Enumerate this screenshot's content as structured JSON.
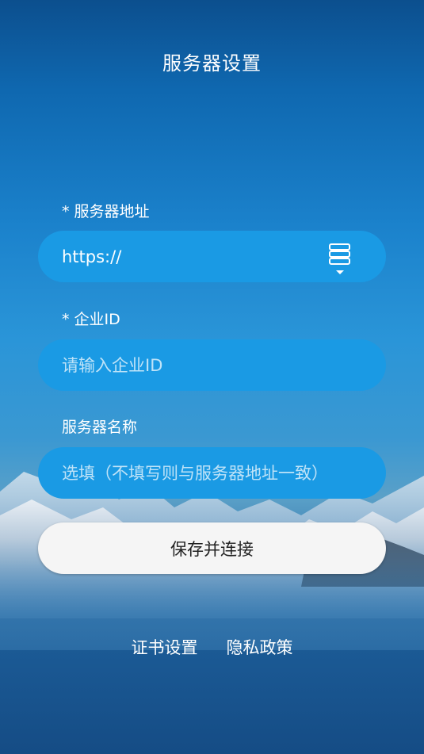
{
  "page": {
    "title": "服务器设置"
  },
  "server_address": {
    "label": "* 服务器地址",
    "value": "https://",
    "picker_icon": "server-list-icon"
  },
  "enterprise_id": {
    "label": "* 企业ID",
    "placeholder": "请输入企业ID",
    "value": ""
  },
  "server_name": {
    "label": "服务器名称",
    "placeholder": "选填（不填写则与服务器地址一致）",
    "value": ""
  },
  "actions": {
    "save_label": "保存并连接"
  },
  "footer_links": {
    "certificate_settings": "证书设置",
    "privacy_policy": "隐私政策"
  },
  "colors": {
    "field_background": "#1a9ae4",
    "button_background": "#f5f5f5",
    "text": "#ffffff"
  }
}
